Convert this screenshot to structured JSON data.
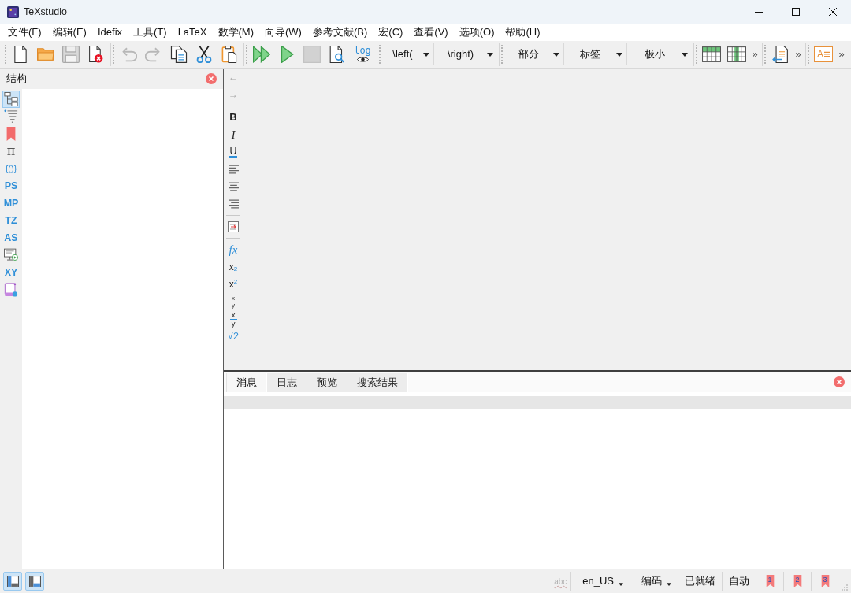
{
  "window": {
    "title": "TeXstudio"
  },
  "menu": [
    "文件(F)",
    "编辑(E)",
    "Idefix",
    "工具(T)",
    "LaTeX",
    "数学(M)",
    "向导(W)",
    "参考文献(B)",
    "宏(C)",
    "查看(V)",
    "选项(O)",
    "帮助(H)"
  ],
  "toolbar": [
    [
      {
        "kind": "new",
        "disabled": false
      },
      {
        "kind": "open",
        "disabled": false
      },
      {
        "kind": "save",
        "disabled": true
      },
      {
        "kind": "close",
        "disabled": false
      }
    ],
    [
      {
        "kind": "undo",
        "disabled": true
      },
      {
        "kind": "redo",
        "disabled": true
      },
      {
        "kind": "copy",
        "disabled": false
      },
      {
        "kind": "cut",
        "disabled": false
      },
      {
        "kind": "paste",
        "disabled": false
      }
    ],
    [
      {
        "kind": "build",
        "disabled": false
      },
      {
        "kind": "compile",
        "disabled": false
      },
      {
        "kind": "stop",
        "disabled": true
      },
      {
        "kind": "view",
        "disabled": false
      },
      {
        "kind": "log",
        "label": "log",
        "disabled": false
      }
    ],
    [
      {
        "kind": "dropdown",
        "label": "\\left(",
        "disabled": false
      },
      {
        "kind": "dropdown",
        "label": "\\right)",
        "disabled": false
      }
    ],
    [
      {
        "kind": "dropdown",
        "label": "部分",
        "disabled": false
      },
      {
        "kind": "dropdown",
        "label": "标签",
        "disabled": false
      },
      {
        "kind": "dropdown",
        "label": "极小",
        "disabled": false
      }
    ],
    [
      {
        "kind": "rows",
        "disabled": false
      },
      {
        "kind": "columns",
        "disabled": false
      },
      {
        "kind": "more",
        "label": "»",
        "disabled": false
      }
    ],
    [
      {
        "kind": "outline",
        "disabled": false
      },
      {
        "kind": "more",
        "label": "»",
        "disabled": false
      }
    ],
    [
      {
        "kind": "frame",
        "label": "A",
        "disabled": false
      },
      {
        "kind": "more",
        "label": "»",
        "disabled": false
      }
    ]
  ],
  "structure_panel": {
    "title": "结构",
    "tabs": [
      {
        "kind": "tree",
        "selected": true
      },
      {
        "kind": "list",
        "selected": false
      },
      {
        "kind": "bookmark",
        "selected": false
      },
      {
        "kind": "symbol",
        "label": "π",
        "selected": false
      },
      {
        "kind": "glyph",
        "label": "{()}",
        "selected": false
      },
      {
        "kind": "glyph",
        "label": "PS",
        "selected": false
      },
      {
        "kind": "glyph",
        "label": "MP",
        "selected": false
      },
      {
        "kind": "glyph",
        "label": "TZ",
        "selected": false
      },
      {
        "kind": "glyph",
        "label": "AS",
        "selected": false
      },
      {
        "kind": "monitor",
        "selected": false
      },
      {
        "kind": "glyph",
        "label": "XY",
        "selected": false
      },
      {
        "kind": "scroll",
        "selected": false
      }
    ]
  },
  "format_toolbar": [
    [
      {
        "kind": "arrow",
        "label": "←",
        "disabled": true
      },
      {
        "kind": "arrow",
        "label": "→",
        "disabled": true
      }
    ],
    [
      {
        "kind": "bold",
        "label": "B",
        "disabled": false
      },
      {
        "kind": "italic",
        "label": "I",
        "disabled": false
      },
      {
        "kind": "underline",
        "label": "U",
        "disabled": false
      },
      {
        "kind": "left",
        "disabled": false
      },
      {
        "kind": "center",
        "disabled": false
      },
      {
        "kind": "right",
        "disabled": false
      }
    ],
    [
      {
        "kind": "insert",
        "disabled": false
      }
    ],
    [
      {
        "kind": "function",
        "label": "fx",
        "disabled": false
      },
      {
        "kind": "subscript",
        "base": "x",
        "script": "2",
        "disabled": false
      },
      {
        "kind": "superscript",
        "base": "x",
        "script": "2",
        "disabled": false
      },
      {
        "kind": "fraction",
        "numerator": "x",
        "denominator": "y",
        "compact": true,
        "disabled": false
      },
      {
        "kind": "fraction",
        "numerator": "x",
        "denominator": "y",
        "compact": false,
        "disabled": false
      },
      {
        "kind": "root",
        "label": "√2",
        "disabled": false
      }
    ]
  ],
  "messages_panel": {
    "tabs": [
      {
        "label": "消息",
        "selected": true
      },
      {
        "label": "日志",
        "selected": false
      },
      {
        "label": "预览",
        "selected": false
      },
      {
        "label": "搜索结果",
        "selected": false
      }
    ]
  },
  "status_bar": {
    "panel_toggles": [
      {
        "kind": "side",
        "checked": true
      },
      {
        "kind": "bottom",
        "checked": true
      }
    ],
    "spell": {
      "label": "abc",
      "disabled": true
    },
    "dropdowns": [
      "en_US",
      "编码"
    ],
    "texts": [
      "已就绪",
      "自动"
    ],
    "bookmarks": [
      "1",
      "2",
      "3"
    ]
  }
}
